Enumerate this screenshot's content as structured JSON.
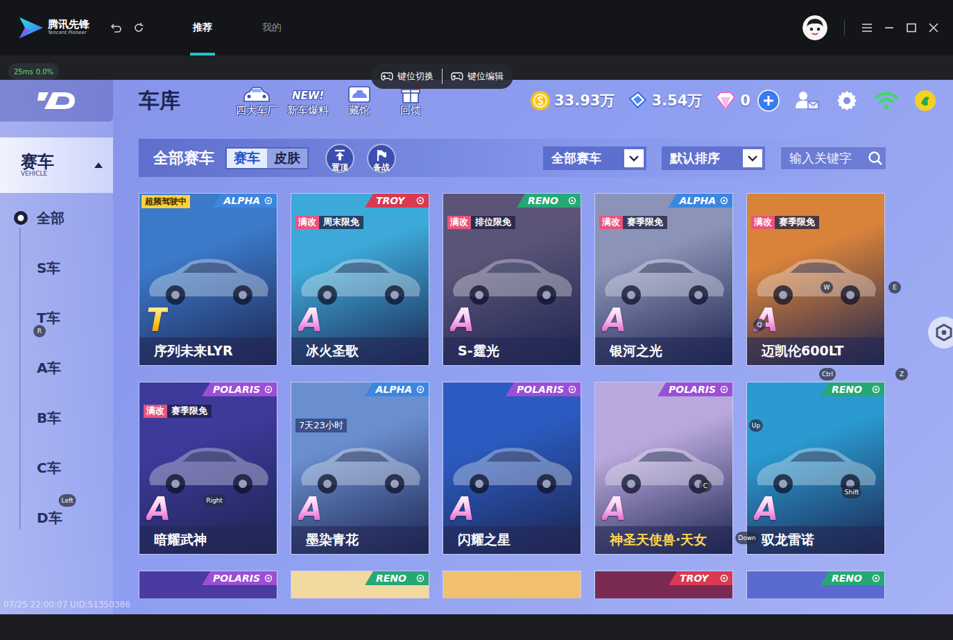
{
  "emulator": {
    "brand": "腾讯先锋",
    "brand_sub": "Tencent Pioneer",
    "tabs": [
      {
        "label": "推荐",
        "selected": true
      },
      {
        "label": "我的",
        "selected": false
      }
    ],
    "stats": {
      "latency": "25ms",
      "loss": "0.0%"
    },
    "toolbar": [
      {
        "label": "键位切换"
      },
      {
        "label": "键位编辑"
      }
    ]
  },
  "sidebar": {
    "section": {
      "title": "赛车",
      "subtitle": "VEHICLE",
      "expanded": true
    },
    "items": [
      {
        "label": "全部",
        "selected": true
      },
      {
        "label": "S车",
        "selected": false
      },
      {
        "label": "T车",
        "selected": false
      },
      {
        "label": "A车",
        "selected": false
      },
      {
        "label": "B车",
        "selected": false
      },
      {
        "label": "C车",
        "selected": false
      },
      {
        "label": "D车",
        "selected": false
      }
    ]
  },
  "header": {
    "title": "车库",
    "shortcuts": [
      {
        "label": "四大车厂",
        "kind": "factory",
        "notice": false
      },
      {
        "label": "新车爆料",
        "kind": "news",
        "badge": "NEW!",
        "notice": false
      },
      {
        "label": "藏馆",
        "kind": "museum",
        "notice": false
      },
      {
        "label": "回馈",
        "kind": "gift",
        "notice": true
      }
    ],
    "currencies": [
      {
        "value": "33.93万",
        "kind": "coin"
      },
      {
        "value": "3.54万",
        "kind": "voucher"
      },
      {
        "value": "0",
        "kind": "diamond"
      }
    ]
  },
  "filters": {
    "title": "全部赛车",
    "toggle": [
      {
        "label": "赛车",
        "selected": true
      },
      {
        "label": "皮肤",
        "selected": false
      }
    ],
    "actions": [
      {
        "label": "置顶",
        "kind": "pin"
      },
      {
        "label": "备战",
        "kind": "flag"
      }
    ],
    "dropdowns": [
      {
        "value": "全部赛车"
      },
      {
        "value": "默认排序"
      }
    ],
    "search": {
      "placeholder": "输入关键字"
    }
  },
  "cards": [
    {
      "name": "序列未来LYR",
      "grade": "T",
      "brand": {
        "name": "ALPHA",
        "color": "#3d86e0"
      },
      "tags": [
        {
          "text": "超频驾驶中",
          "kind": "status"
        }
      ],
      "color": "#3b79c9",
      "name_color": "#ffffff"
    },
    {
      "name": "冰火圣歌",
      "grade": "A",
      "brand": {
        "name": "TROY",
        "color": "#d83a52"
      },
      "tags": [
        {
          "text": "满改",
          "kind": "mod"
        },
        {
          "text": "周末限免",
          "kind": "free"
        }
      ],
      "color": "#3da9d9",
      "name_color": "#ffffff"
    },
    {
      "name": "S-霆光",
      "grade": "A",
      "brand": {
        "name": "RENO",
        "color": "#25a876"
      },
      "tags": [
        {
          "text": "满改",
          "kind": "mod"
        },
        {
          "text": "排位限免",
          "kind": "free"
        }
      ],
      "color": "#5b5478",
      "name_color": "#ffffff"
    },
    {
      "name": "银河之光",
      "grade": "A",
      "brand": {
        "name": "ALPHA",
        "color": "#3d86e0"
      },
      "tags": [
        {
          "text": "满改",
          "kind": "mod"
        },
        {
          "text": "赛季限免",
          "kind": "free"
        }
      ],
      "color": "#8b93b8",
      "name_color": "#ffffff"
    },
    {
      "name": "迈凯伦600LT",
      "grade": "A",
      "tags": [
        {
          "text": "满改",
          "kind": "mod"
        },
        {
          "text": "赛季限免",
          "kind": "free"
        }
      ],
      "color": "#d9823a",
      "name_color": "#ffffff"
    },
    {
      "name": "暗耀武神",
      "grade": "A",
      "brand": {
        "name": "POLARIS",
        "color": "#9b4fd6"
      },
      "tags": [
        {
          "text": "满改",
          "kind": "mod"
        },
        {
          "text": "赛季限免",
          "kind": "free"
        }
      ],
      "color": "#3d3a9a",
      "name_color": "#ffffff"
    },
    {
      "name": "墨染青花",
      "grade": "A",
      "brand": {
        "name": "ALPHA",
        "color": "#3d86e0"
      },
      "tags": [
        {
          "text": "7天23小时",
          "kind": "timer"
        }
      ],
      "color": "#6a8fd0",
      "name_color": "#ffffff"
    },
    {
      "name": "闪耀之星",
      "grade": "A",
      "brand": {
        "name": "POLARIS",
        "color": "#9b4fd6"
      },
      "tags": [],
      "color": "#2b5bc0",
      "name_color": "#ffffff"
    },
    {
      "name": "神圣天使兽·天女",
      "grade": "A",
      "brand": {
        "name": "POLARIS",
        "color": "#9b4fd6"
      },
      "tags": [],
      "color": "#b9a8de",
      "name_color": "#ffd84a"
    },
    {
      "name": "驭龙雷诺",
      "grade": "A",
      "brand": {
        "name": "RENO",
        "color": "#25a876"
      },
      "tags": [],
      "color": "#2a9ad0",
      "name_color": "#ffffff"
    },
    {
      "brand": {
        "name": "POLARIS",
        "color": "#9b4fd6"
      },
      "tags": [],
      "color": "#4b3aa0"
    },
    {
      "brand": {
        "name": "RENO",
        "color": "#25a876"
      },
      "tags": [],
      "color": "#f2d9a0"
    },
    {
      "tags": [],
      "color": "#f0c070"
    },
    {
      "brand": {
        "name": "TROY",
        "color": "#d83a52"
      },
      "tags": [],
      "color": "#7a2a50"
    },
    {
      "brand": {
        "name": "RENO",
        "color": "#25a876"
      },
      "tags": [],
      "color": "#5a6ad0"
    }
  ],
  "key_hints": [
    "E",
    "R",
    "W",
    "Q",
    "Ctrl",
    "Z",
    "Up",
    "Left",
    "Right",
    "C",
    "Shift",
    "Down"
  ],
  "watermark": "07/25 22:00:07 UID:51350386"
}
